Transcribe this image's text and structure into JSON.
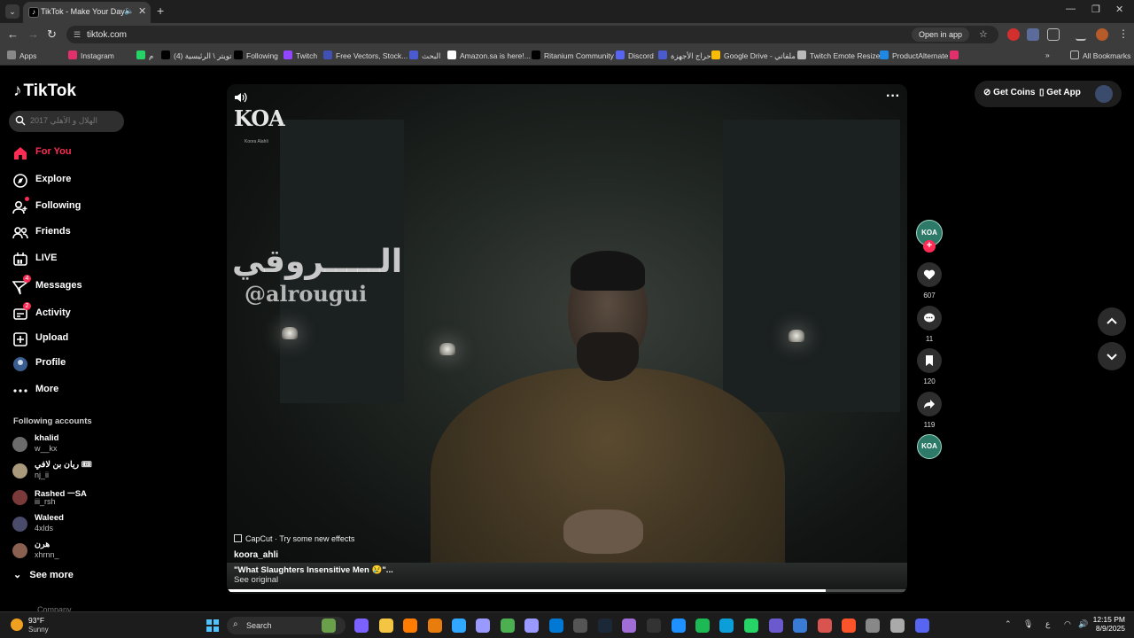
{
  "browser": {
    "tab_title": "TikTok - Make Your Day",
    "url": "tiktok.com",
    "open_in_app": "Open in app",
    "bookmarks": [
      {
        "label": "Apps",
        "color": "#888888"
      },
      {
        "label": "Instagram",
        "color": "#e1306c"
      },
      {
        "label": "م",
        "color": "#25d366"
      },
      {
        "label": "(4) تويتر \\ الرئيسية",
        "color": "#000000"
      },
      {
        "label": "Following",
        "color": "#000000"
      },
      {
        "label": "Twitch",
        "color": "#9146ff"
      },
      {
        "label": "Free Vectors, Stock...",
        "color": "#3f51b5"
      },
      {
        "label": "البحث",
        "color": "#4a5bd0"
      },
      {
        "label": "Amazon.sa is here!...",
        "color": "#ffffff"
      },
      {
        "label": "Ritanium Community",
        "color": "#000000"
      },
      {
        "label": "Discord",
        "color": "#5865f2"
      },
      {
        "label": "حراج الأجهزة",
        "color": "#4a5bd0"
      },
      {
        "label": "Google Drive - ملفاتي",
        "color": "#fbbc04"
      },
      {
        "label": "Twitch Emote Resizer",
        "color": "#bbbbbb"
      },
      {
        "label": "ProductAlternate",
        "color": "#1e88e5"
      }
    ],
    "all_bookmarks": "All Bookmarks"
  },
  "sidebar": {
    "logo": "TikTok",
    "search_placeholder": "الهلال و الأهلي 2017",
    "nav": [
      {
        "label": "For You",
        "icon": "home-icon"
      },
      {
        "label": "Explore",
        "icon": "compass-icon"
      },
      {
        "label": "Following",
        "icon": "user-follow-icon"
      },
      {
        "label": "Friends",
        "icon": "friends-icon"
      },
      {
        "label": "LIVE",
        "icon": "live-icon"
      },
      {
        "label": "Messages",
        "icon": "send-icon",
        "badge": "4"
      },
      {
        "label": "Activity",
        "icon": "activity-icon",
        "badge": "2"
      },
      {
        "label": "Upload",
        "icon": "upload-icon"
      },
      {
        "label": "Profile",
        "icon": "avatar"
      },
      {
        "label": "More",
        "icon": "more-icon"
      }
    ],
    "following_title": "Following accounts",
    "accounts": [
      {
        "name": "khalid",
        "handle": "w__kx"
      },
      {
        "name": "ريان بن لافي 🎟",
        "handle": "nj_ii"
      },
      {
        "name": "Rashed ᅳSA",
        "handle": "iii_rsh"
      },
      {
        "name": "Waleed",
        "handle": "4xlds"
      },
      {
        "name": "هرن",
        "handle": "xhrnn_"
      }
    ],
    "see_more": "See more",
    "company": "Company"
  },
  "video": {
    "channel_logo": "KOA",
    "channel_logo_sub": "Koora Alahli",
    "watermark_arabic": "الـــــروقي",
    "watermark_handle": "@alrougui",
    "capcut": "CapCut · Try some new effects",
    "author": "koora_ahli",
    "description": "\"What Slaughters Insensitive Men 😢\"...",
    "see_original": "See original",
    "progress": 0.88
  },
  "actions": {
    "avatar_text": "KOA",
    "likes": "607",
    "comments": "11",
    "saves": "120",
    "shares": "119"
  },
  "header_right": {
    "get_coins": "Get Coins",
    "get_app": "Get App"
  },
  "taskbar": {
    "temp": "93°F",
    "weather": "Sunny",
    "search": "Search",
    "time": "12:15 PM",
    "date": "8/9/2025",
    "lang": "ع"
  }
}
